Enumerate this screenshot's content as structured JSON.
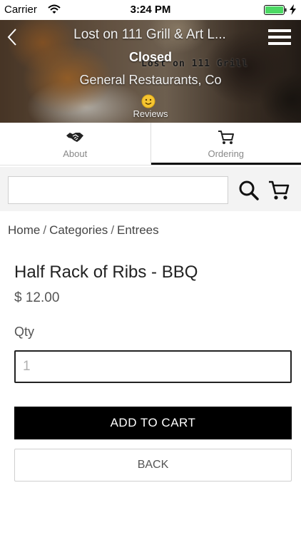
{
  "status_bar": {
    "carrier": "Carrier",
    "time": "3:24 PM",
    "battery_color": "#4cd964"
  },
  "header": {
    "store_name": "Lost on 111 Grill & Art L...",
    "status": "Closed",
    "category": "General Restaurants, Co",
    "sign_text": "Lost on 111 Grill",
    "reviews_label": "Reviews",
    "reviews_icon": "smiley-icon",
    "back_icon": "chevron-left-icon",
    "menu_icon": "hamburger-menu-icon"
  },
  "tabs": [
    {
      "label": "About",
      "icon": "handshake-icon",
      "active": false
    },
    {
      "label": "Ordering",
      "icon": "cart-icon",
      "active": true
    }
  ],
  "search": {
    "value": "",
    "placeholder": "",
    "search_icon": "search-icon",
    "cart_icon": "cart-icon"
  },
  "breadcrumb": {
    "items": [
      "Home",
      "Categories",
      "Entrees"
    ],
    "separator": "/"
  },
  "product": {
    "title": "Half Rack of Ribs - BBQ",
    "price": "$ 12.00",
    "qty_label": "Qty",
    "qty_placeholder": "1",
    "qty_value": ""
  },
  "actions": {
    "add_to_cart_label": "ADD TO CART",
    "back_label": "BACK"
  },
  "colors": {
    "primary_button": "#000000",
    "active_tab_underline": "#111111"
  }
}
